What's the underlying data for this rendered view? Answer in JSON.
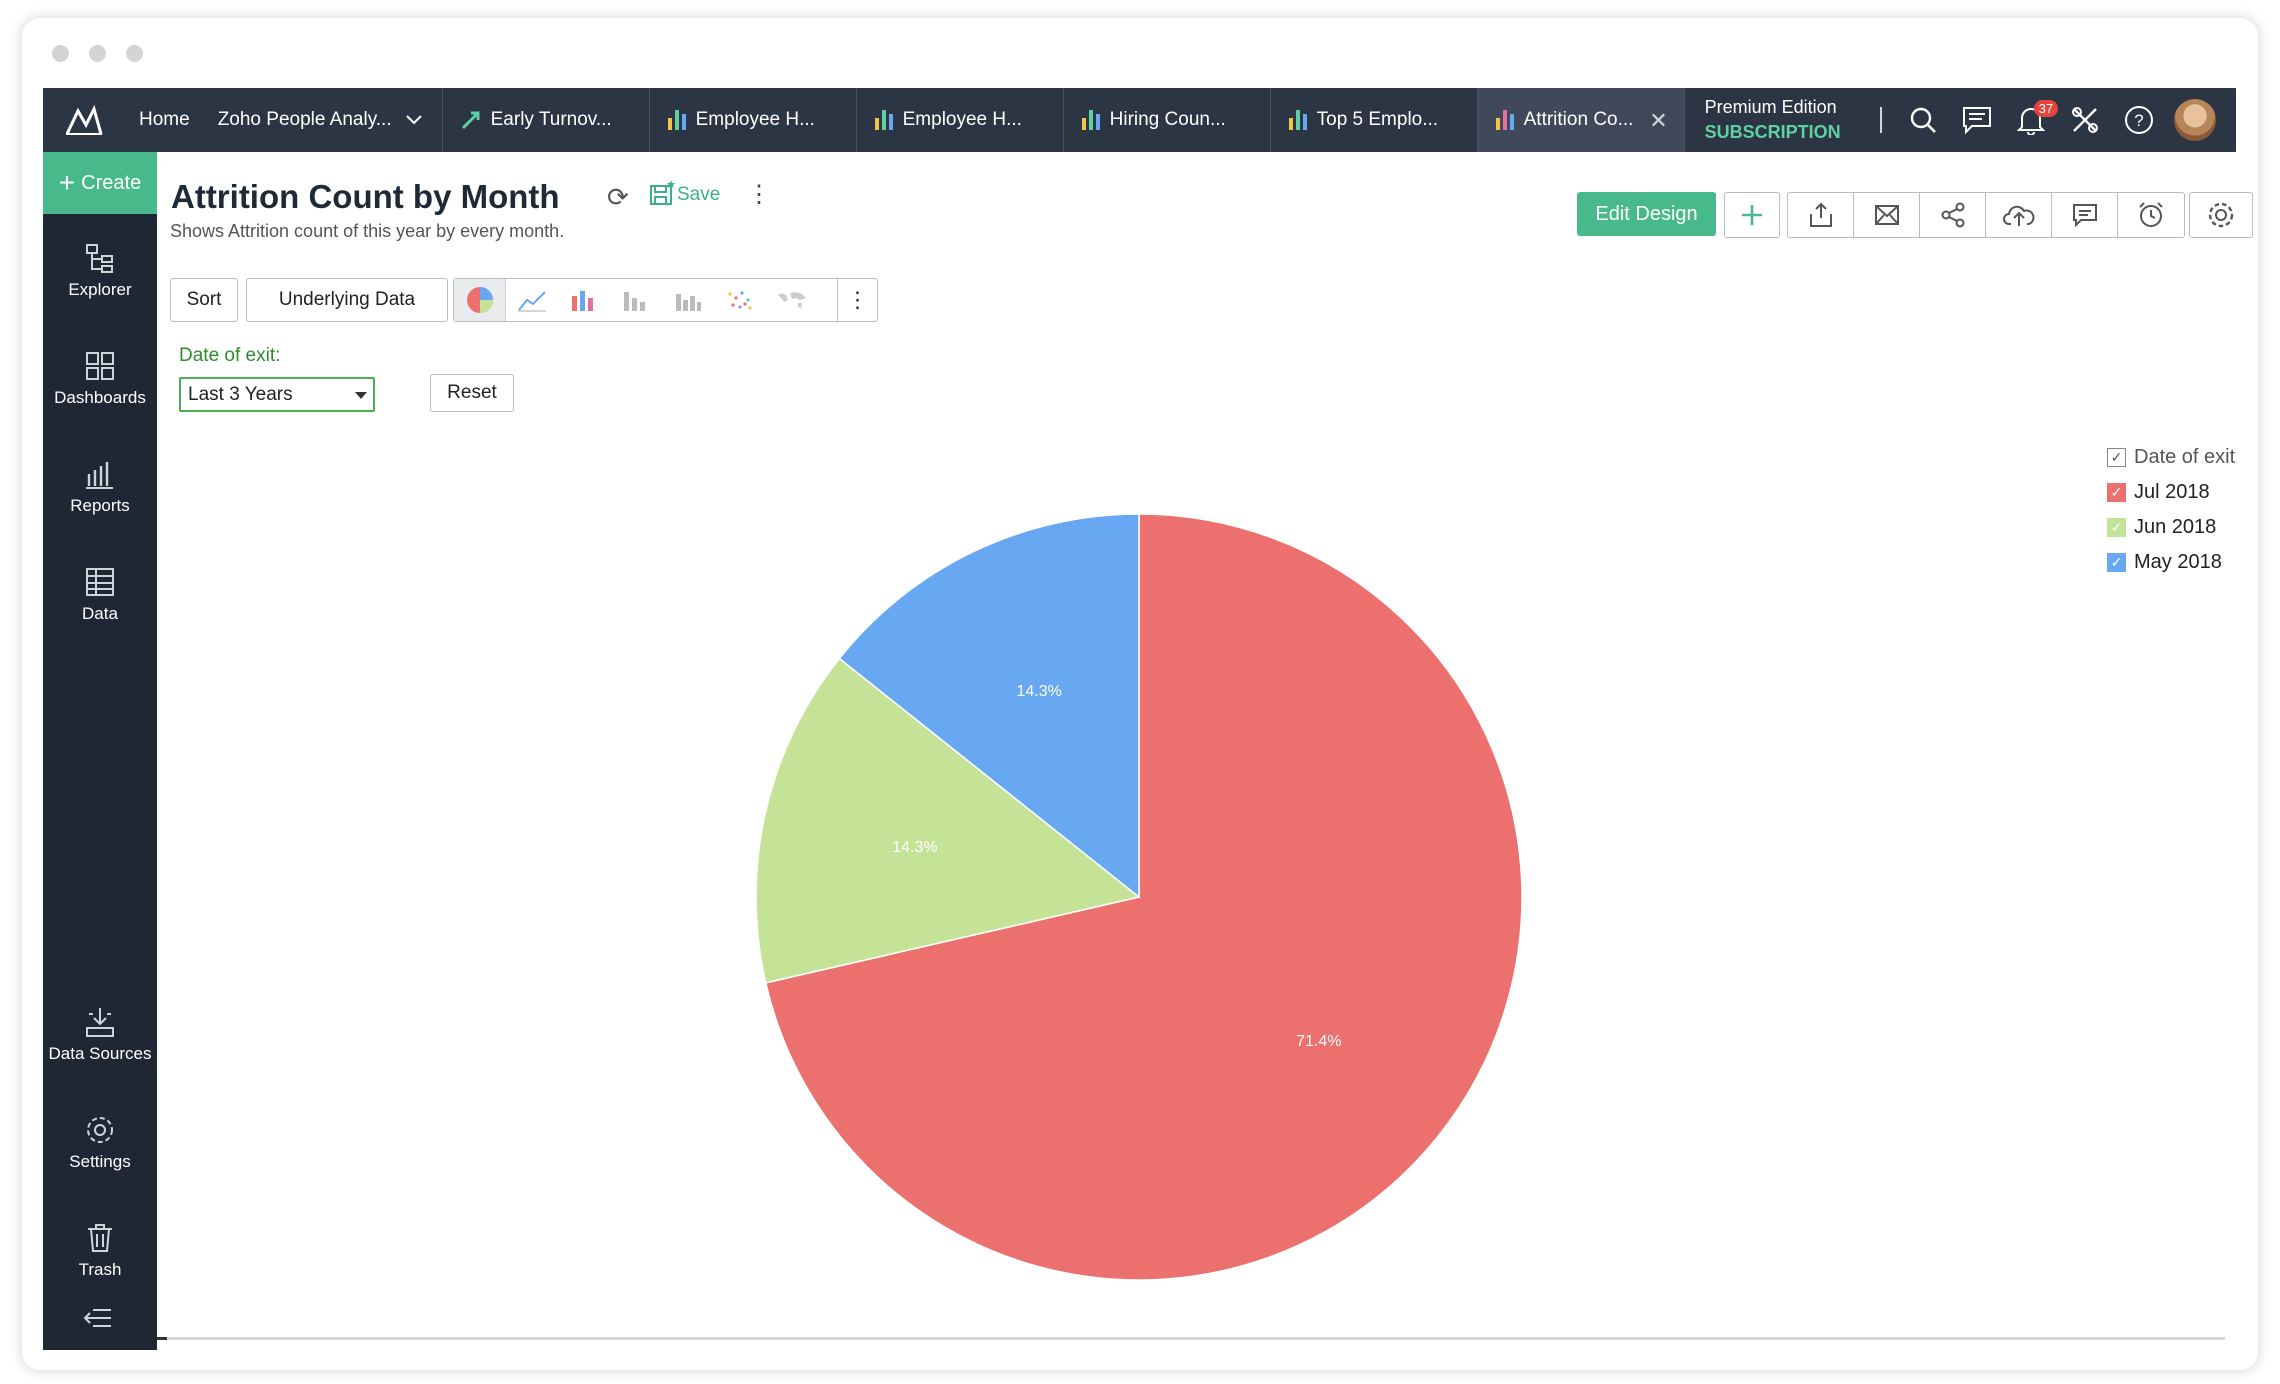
{
  "nav": {
    "home": "Home",
    "workspace": "Zoho People Analy...",
    "tabs": [
      {
        "label": "Early Turnov...",
        "icon": "pivot-icon"
      },
      {
        "label": "Employee H...",
        "icon": "bar-chart-icon"
      },
      {
        "label": "Employee H...",
        "icon": "bar-chart-icon"
      },
      {
        "label": "Hiring Coun...",
        "icon": "bar-chart-icon"
      },
      {
        "label": "Top 5 Emplo...",
        "icon": "bar-chart-icon"
      },
      {
        "label": "Attrition Co...",
        "icon": "bar-chart-icon",
        "active": true
      }
    ],
    "edition": "Premium Edition",
    "subscription": "SUBSCRIPTION",
    "notification_count": "37"
  },
  "sidebar": {
    "create": "Create",
    "items": [
      {
        "label": "Explorer"
      },
      {
        "label": "Dashboards"
      },
      {
        "label": "Reports"
      },
      {
        "label": "Data"
      },
      {
        "label": "Data Sources"
      },
      {
        "label": "Settings"
      },
      {
        "label": "Trash"
      }
    ]
  },
  "report": {
    "title": "Attrition Count by Month",
    "subtitle": "Shows Attrition count of this year by every month.",
    "save": "Save",
    "sort": "Sort",
    "underlying_data": "Underlying Data",
    "edit_design": "Edit Design",
    "filter_label": "Date of exit:",
    "filter_value": "Last 3 Years",
    "reset": "Reset"
  },
  "colors": {
    "accent": "#47b98a",
    "nav_bg": "#2c3544",
    "sidebar_bg": "#1f2735"
  },
  "chart_data": {
    "type": "pie",
    "legend_title": "Date of exit",
    "categories": [
      "Jul 2018",
      "Jun 2018",
      "May 2018"
    ],
    "values": [
      71.4,
      14.3,
      14.3
    ],
    "labels": [
      "71.4%",
      "14.3%",
      "14.3%"
    ],
    "colors": [
      "#ec706d",
      "#c5e396",
      "#68a8f3"
    ],
    "legend_placement": "top-right"
  }
}
